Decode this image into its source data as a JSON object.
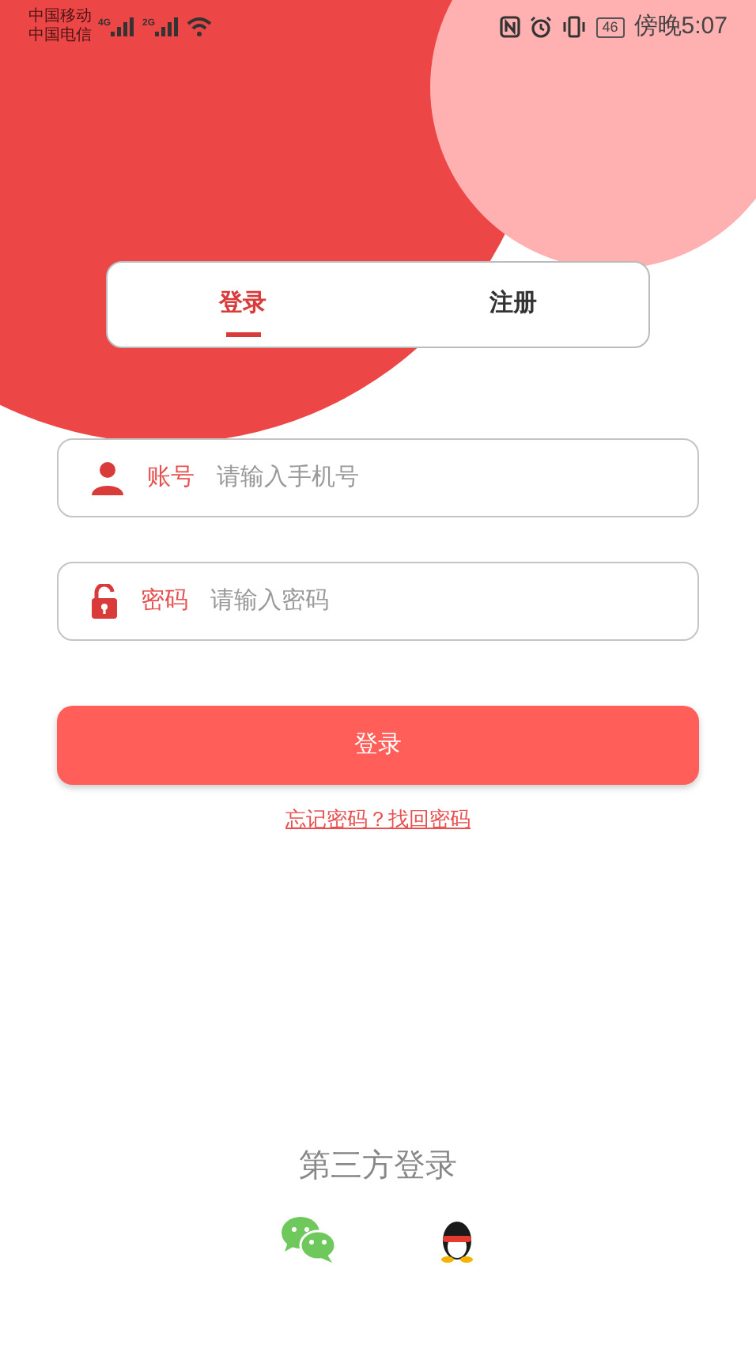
{
  "status_bar": {
    "carriers": [
      "中国移动",
      "中国电信"
    ],
    "network_labels": [
      "4G",
      "2G"
    ],
    "battery": "46",
    "time": "傍晚5:07"
  },
  "tabs": [
    {
      "label": "登录",
      "selected": true
    },
    {
      "label": "注册",
      "selected": false
    }
  ],
  "fields": [
    {
      "kind": "account",
      "label": "账号",
      "placeholder": "请输入手机号"
    },
    {
      "kind": "password",
      "label": "密码",
      "placeholder": "请输入密码"
    }
  ],
  "login_button": "登录",
  "forgot_link": "忘记密码？找回密码",
  "third_party": {
    "title": "第三方登录",
    "providers": [
      {
        "kind": "wechat"
      },
      {
        "kind": "qq"
      }
    ]
  }
}
